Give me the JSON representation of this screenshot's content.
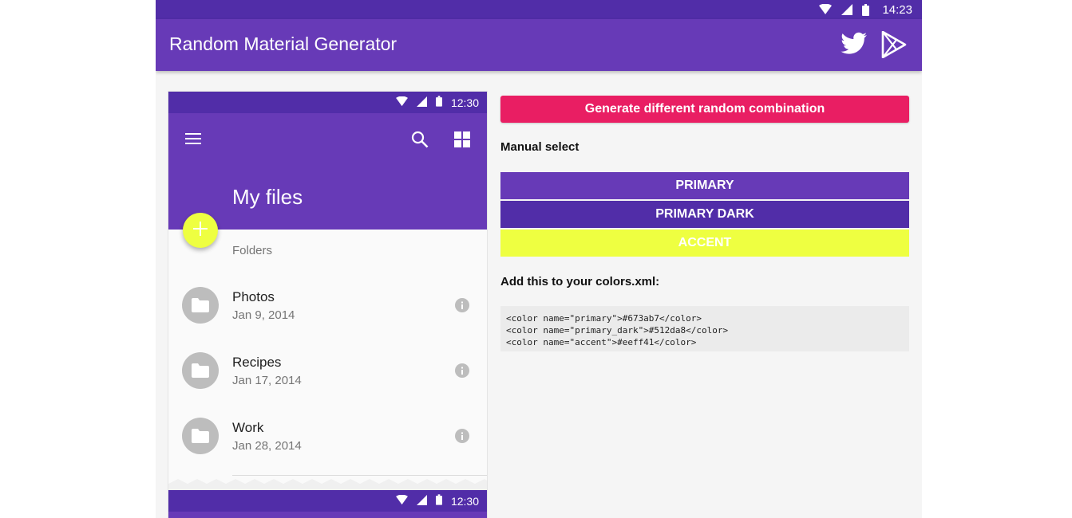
{
  "status_bar": {
    "time": "14:23"
  },
  "app_bar": {
    "title": "Random Material Generator",
    "icons": [
      "twitter-icon",
      "google-play-icon"
    ]
  },
  "phone_preview": {
    "status_time": "12:30",
    "toolbar_title": "My files",
    "fab_icon": "plus-icon",
    "section_label": "Folders",
    "items": [
      {
        "name": "Photos",
        "date": "Jan 9, 2014"
      },
      {
        "name": "Recipes",
        "date": "Jan 17, 2014"
      },
      {
        "name": "Work",
        "date": "Jan 28, 2014"
      }
    ],
    "bottom_status_time": "12:30"
  },
  "controls": {
    "generate_label": "Generate different random combination",
    "manual_select_label": "Manual select",
    "swatches": [
      {
        "label": "PRIMARY",
        "color": "#673ab7"
      },
      {
        "label": "PRIMARY DARK",
        "color": "#512da8"
      },
      {
        "label": "ACCENT",
        "color": "#eeff41"
      }
    ],
    "colors_xml_label": "Add this to your colors.xml:",
    "code_lines": [
      "<color name=\"primary\">#673ab7</color>",
      "<color name=\"primary_dark\">#512da8</color>",
      "<color name=\"accent\">#eeff41</color>"
    ]
  },
  "colors": {
    "primary": "#673ab7",
    "primary_dark": "#512da8",
    "accent": "#eeff41",
    "button": "#e91e63"
  }
}
